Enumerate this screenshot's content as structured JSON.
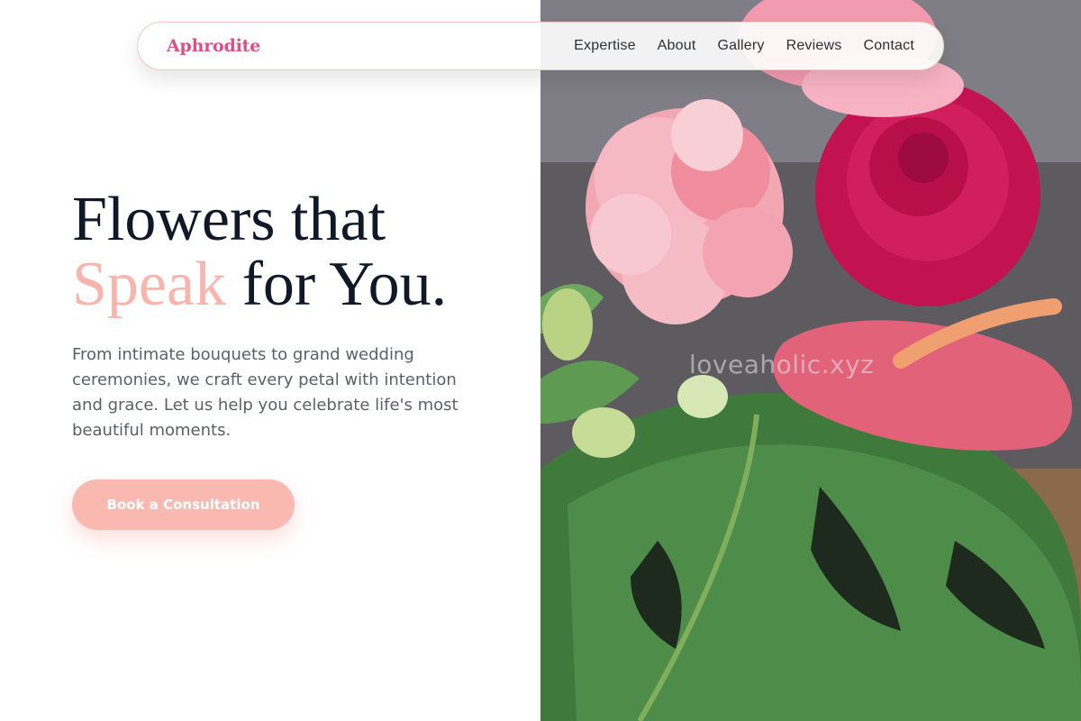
{
  "brand": {
    "name": "Aphrodite",
    "accent_color": "#d94f8a"
  },
  "nav": {
    "items": [
      {
        "label": "Expertise"
      },
      {
        "label": "About"
      },
      {
        "label": "Gallery"
      },
      {
        "label": "Reviews"
      },
      {
        "label": "Contact"
      }
    ]
  },
  "hero": {
    "title_line1": "Flowers that",
    "title_accent": "Speak",
    "title_line2_rest": " for You.",
    "description": "From intimate bouquets to grand wedding ceremonies, we craft every petal with intention and grace. Let us help you celebrate life's most beautiful moments.",
    "cta_label": "Book a Consultation",
    "accent_color": "#f7b5ad",
    "button_color": "#f9b9b0"
  },
  "photo": {
    "subject": "pink flower bouquet with monstera leaves",
    "watermark": "loveaholic.xyz"
  }
}
